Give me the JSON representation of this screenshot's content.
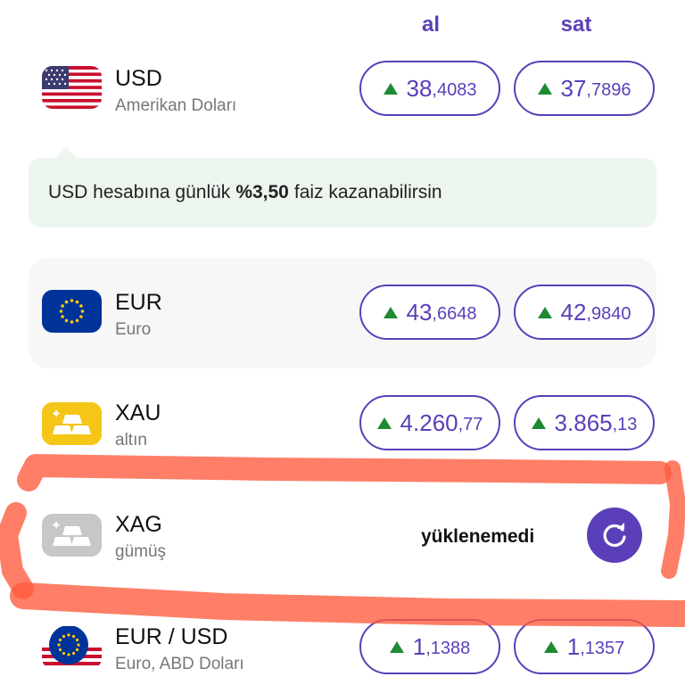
{
  "headers": {
    "buy": "al",
    "sell": "sat"
  },
  "rows": [
    {
      "code": "USD",
      "name": "Amerikan Doları",
      "buy_int": "38",
      "buy_dec": ",4083",
      "sell_int": "37",
      "sell_dec": ",7896",
      "flag_icon": "us-flag-icon",
      "trend": "up"
    },
    {
      "code": "EUR",
      "name": "Euro",
      "buy_int": "43",
      "buy_dec": ",6648",
      "sell_int": "42",
      "sell_dec": ",9840",
      "flag_icon": "eu-flag-icon",
      "trend": "up"
    },
    {
      "code": "XAU",
      "name": "altın",
      "buy_int": "4.260",
      "buy_dec": ",77",
      "sell_int": "3.865",
      "sell_dec": ",13",
      "flag_icon": "gold-bars-icon",
      "trend": "up"
    },
    {
      "code": "XAG",
      "name": "gümüş",
      "status": "yüklenemedi",
      "flag_icon": "silver-bars-icon"
    },
    {
      "code": "EUR / USD",
      "name": "Euro, ABD Doları",
      "buy_int": "1",
      "buy_dec": ",1388",
      "sell_int": "1",
      "sell_dec": ",1357",
      "flag_icon": "eu-us-flag-icon",
      "trend": "up"
    }
  ],
  "banner": {
    "prefix": "USD hesabına günlük",
    "rate": "%3,50",
    "suffix": "faiz kazanabilirsin"
  },
  "colors": {
    "accent": "#5b3fb8",
    "up": "#1e8a33",
    "banner_bg": "#edf6ee",
    "marker": "#ff5a3c"
  }
}
